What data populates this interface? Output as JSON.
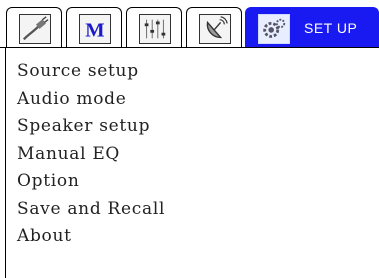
{
  "tabs": [
    {
      "icon": "cable-icon"
    },
    {
      "icon": "m-logo-icon",
      "letter": "M"
    },
    {
      "icon": "equalizer-icon"
    },
    {
      "icon": "satellite-dish-icon"
    },
    {
      "icon": "gear-icon",
      "label": "SET UP",
      "active": true
    }
  ],
  "menu": {
    "items": [
      "Source setup",
      "Audio mode",
      "Speaker setup",
      "Manual EQ",
      "Option",
      "Save and Recall",
      "About"
    ]
  },
  "colors": {
    "active_tab": "#1919f2",
    "active_label": "#ffffff",
    "m_letter": "#1a1acc",
    "border": "#000000"
  }
}
